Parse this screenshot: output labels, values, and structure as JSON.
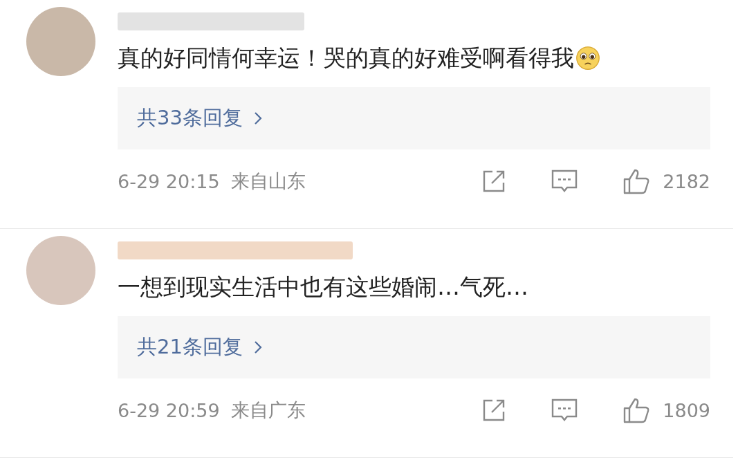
{
  "comments": [
    {
      "text": "真的好同情何幸运！哭的真的好难受啊看得我",
      "trailing_emoji": true,
      "replies": "共33条回复",
      "date": "6-29 20:15",
      "location": "来自山东",
      "likes": "2182"
    },
    {
      "text": "一想到现实生活中也有这些婚闹…气死…",
      "trailing_emoji": false,
      "replies": "共21条回复",
      "date": "6-29 20:59",
      "location": "来自广东",
      "likes": "1809"
    }
  ]
}
